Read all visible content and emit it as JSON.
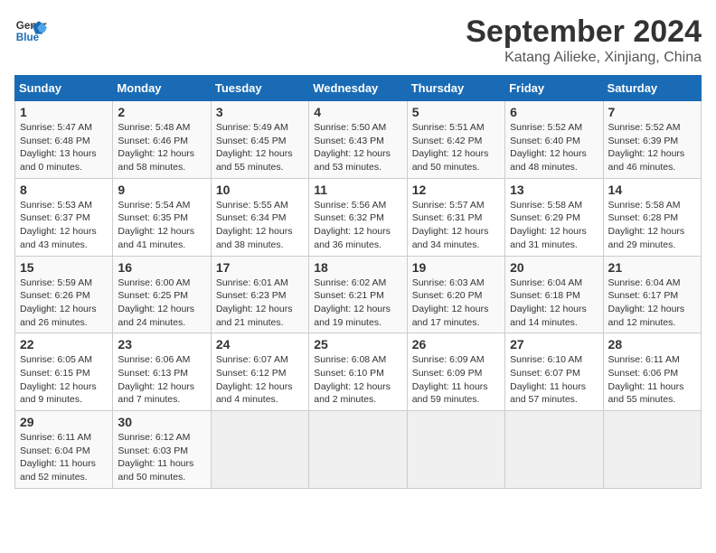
{
  "header": {
    "logo_line1": "General",
    "logo_line2": "Blue",
    "title": "September 2024",
    "subtitle": "Katang Ailieke, Xinjiang, China"
  },
  "columns": [
    "Sunday",
    "Monday",
    "Tuesday",
    "Wednesday",
    "Thursday",
    "Friday",
    "Saturday"
  ],
  "weeks": [
    [
      {
        "day": "1",
        "info": "Sunrise: 5:47 AM\nSunset: 6:48 PM\nDaylight: 13 hours\nand 0 minutes."
      },
      {
        "day": "2",
        "info": "Sunrise: 5:48 AM\nSunset: 6:46 PM\nDaylight: 12 hours\nand 58 minutes."
      },
      {
        "day": "3",
        "info": "Sunrise: 5:49 AM\nSunset: 6:45 PM\nDaylight: 12 hours\nand 55 minutes."
      },
      {
        "day": "4",
        "info": "Sunrise: 5:50 AM\nSunset: 6:43 PM\nDaylight: 12 hours\nand 53 minutes."
      },
      {
        "day": "5",
        "info": "Sunrise: 5:51 AM\nSunset: 6:42 PM\nDaylight: 12 hours\nand 50 minutes."
      },
      {
        "day": "6",
        "info": "Sunrise: 5:52 AM\nSunset: 6:40 PM\nDaylight: 12 hours\nand 48 minutes."
      },
      {
        "day": "7",
        "info": "Sunrise: 5:52 AM\nSunset: 6:39 PM\nDaylight: 12 hours\nand 46 minutes."
      }
    ],
    [
      {
        "day": "8",
        "info": "Sunrise: 5:53 AM\nSunset: 6:37 PM\nDaylight: 12 hours\nand 43 minutes."
      },
      {
        "day": "9",
        "info": "Sunrise: 5:54 AM\nSunset: 6:35 PM\nDaylight: 12 hours\nand 41 minutes."
      },
      {
        "day": "10",
        "info": "Sunrise: 5:55 AM\nSunset: 6:34 PM\nDaylight: 12 hours\nand 38 minutes."
      },
      {
        "day": "11",
        "info": "Sunrise: 5:56 AM\nSunset: 6:32 PM\nDaylight: 12 hours\nand 36 minutes."
      },
      {
        "day": "12",
        "info": "Sunrise: 5:57 AM\nSunset: 6:31 PM\nDaylight: 12 hours\nand 34 minutes."
      },
      {
        "day": "13",
        "info": "Sunrise: 5:58 AM\nSunset: 6:29 PM\nDaylight: 12 hours\nand 31 minutes."
      },
      {
        "day": "14",
        "info": "Sunrise: 5:58 AM\nSunset: 6:28 PM\nDaylight: 12 hours\nand 29 minutes."
      }
    ],
    [
      {
        "day": "15",
        "info": "Sunrise: 5:59 AM\nSunset: 6:26 PM\nDaylight: 12 hours\nand 26 minutes."
      },
      {
        "day": "16",
        "info": "Sunrise: 6:00 AM\nSunset: 6:25 PM\nDaylight: 12 hours\nand 24 minutes."
      },
      {
        "day": "17",
        "info": "Sunrise: 6:01 AM\nSunset: 6:23 PM\nDaylight: 12 hours\nand 21 minutes."
      },
      {
        "day": "18",
        "info": "Sunrise: 6:02 AM\nSunset: 6:21 PM\nDaylight: 12 hours\nand 19 minutes."
      },
      {
        "day": "19",
        "info": "Sunrise: 6:03 AM\nSunset: 6:20 PM\nDaylight: 12 hours\nand 17 minutes."
      },
      {
        "day": "20",
        "info": "Sunrise: 6:04 AM\nSunset: 6:18 PM\nDaylight: 12 hours\nand 14 minutes."
      },
      {
        "day": "21",
        "info": "Sunrise: 6:04 AM\nSunset: 6:17 PM\nDaylight: 12 hours\nand 12 minutes."
      }
    ],
    [
      {
        "day": "22",
        "info": "Sunrise: 6:05 AM\nSunset: 6:15 PM\nDaylight: 12 hours\nand 9 minutes."
      },
      {
        "day": "23",
        "info": "Sunrise: 6:06 AM\nSunset: 6:13 PM\nDaylight: 12 hours\nand 7 minutes."
      },
      {
        "day": "24",
        "info": "Sunrise: 6:07 AM\nSunset: 6:12 PM\nDaylight: 12 hours\nand 4 minutes."
      },
      {
        "day": "25",
        "info": "Sunrise: 6:08 AM\nSunset: 6:10 PM\nDaylight: 12 hours\nand 2 minutes."
      },
      {
        "day": "26",
        "info": "Sunrise: 6:09 AM\nSunset: 6:09 PM\nDaylight: 11 hours\nand 59 minutes."
      },
      {
        "day": "27",
        "info": "Sunrise: 6:10 AM\nSunset: 6:07 PM\nDaylight: 11 hours\nand 57 minutes."
      },
      {
        "day": "28",
        "info": "Sunrise: 6:11 AM\nSunset: 6:06 PM\nDaylight: 11 hours\nand 55 minutes."
      }
    ],
    [
      {
        "day": "29",
        "info": "Sunrise: 6:11 AM\nSunset: 6:04 PM\nDaylight: 11 hours\nand 52 minutes."
      },
      {
        "day": "30",
        "info": "Sunrise: 6:12 AM\nSunset: 6:03 PM\nDaylight: 11 hours\nand 50 minutes."
      },
      {
        "day": "",
        "info": ""
      },
      {
        "day": "",
        "info": ""
      },
      {
        "day": "",
        "info": ""
      },
      {
        "day": "",
        "info": ""
      },
      {
        "day": "",
        "info": ""
      }
    ]
  ]
}
